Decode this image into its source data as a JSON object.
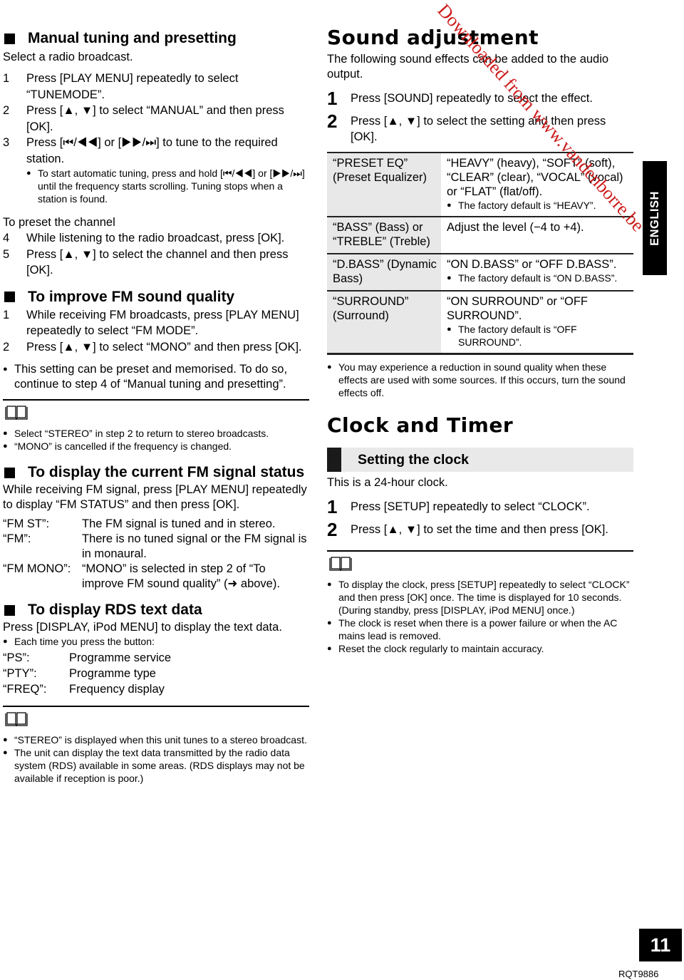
{
  "left": {
    "manual_tuning": {
      "title": "Manual tuning and presetting",
      "intro": "Select a radio broadcast.",
      "steps": [
        {
          "num": "1",
          "text": "Press [PLAY MENU] repeatedly to select “TUNEMODE”."
        },
        {
          "num": "2",
          "text": "Press [▲, ▼] to select “MANUAL” and then press [OK]."
        },
        {
          "num": "3",
          "text": "Press [⏮/◀◀] or [▶▶/⏭] to tune to the required station."
        }
      ],
      "step3_note": "To start automatic tuning, press and hold [⏮/◀◀] or [▶▶/⏭] until the frequency starts scrolling. Tuning stops when a station is found.",
      "preset_heading": "To preset the channel",
      "preset_steps": [
        {
          "num": "4",
          "text": "While listening to the radio broadcast, press [OK]."
        },
        {
          "num": "5",
          "text": "Press [▲, ▼] to select the channel and then press [OK]."
        }
      ]
    },
    "fm_quality": {
      "title": "To improve FM sound quality",
      "steps": [
        {
          "num": "1",
          "text": "While receiving FM broadcasts, press [PLAY MENU] repeatedly to select “FM MODE”."
        },
        {
          "num": "2",
          "text": "Press [▲, ▼] to select “MONO” and then press [OK]."
        }
      ],
      "note": "This setting can be preset and memorised. To do so, continue to step 4 of “Manual tuning and presetting”.",
      "tips_icon": "book-icon",
      "tips": [
        "Select “STEREO” in step 2 to return to stereo broadcasts.",
        "“MONO” is cancelled if the frequency is changed."
      ]
    },
    "fm_status": {
      "title": "To display the current FM signal status",
      "intro": "While receiving FM signal, press [PLAY MENU] repeatedly to display “FM STATUS” and then press [OK].",
      "items": [
        {
          "term": "“FM ST”:",
          "desc": "The FM signal is tuned and in stereo."
        },
        {
          "term": "“FM”:",
          "desc": "There is no tuned signal or the FM signal is in monaural."
        },
        {
          "term": "“FM MONO”:",
          "desc": "“MONO” is selected in step 2 of “To improve FM sound quality” (➜ above)."
        }
      ]
    },
    "rds": {
      "title": "To display RDS text data",
      "intro": "Press [DISPLAY, iPod MENU] to display the text data.",
      "bullet": "Each time you press the button:",
      "items": [
        {
          "term": "“PS”:",
          "desc": "Programme service"
        },
        {
          "term": "“PTY”:",
          "desc": "Programme type"
        },
        {
          "term": "“FREQ”:",
          "desc": "Frequency display"
        }
      ],
      "tips_icon": "book-icon",
      "tips": [
        "“STEREO” is displayed when this unit tunes to a stereo broadcast.",
        "The unit can display the text data transmitted by the radio data system (RDS) available in some areas. (RDS displays may not be available if reception is poor.)"
      ]
    }
  },
  "right": {
    "sound": {
      "title": "Sound adjustment",
      "intro": "The following sound effects can be added to the audio output.",
      "steps": [
        {
          "num": "1",
          "text": "Press [SOUND] repeatedly to select the effect."
        },
        {
          "num": "2",
          "text": "Press [▲, ▼] to select the setting and then press [OK]."
        }
      ],
      "table": [
        {
          "key": "“PRESET EQ” (Preset Equalizer)",
          "value": "“HEAVY” (heavy), “SOFT” (soft), “CLEAR” (clear), “VOCAL” (vocal) or “FLAT” (flat/off).",
          "note": "The factory default is “HEAVY”."
        },
        {
          "key": "“BASS” (Bass) or “TREBLE” (Treble)",
          "value": "Adjust the level (−4 to +4).",
          "note": ""
        },
        {
          "key": "“D.BASS” (Dynamic Bass)",
          "value": "“ON D.BASS” or “OFF D.BASS”.",
          "note": "The factory default is “ON D.BASS”."
        },
        {
          "key": "“SURROUND” (Surround)",
          "value": "“ON SURROUND” or “OFF SURROUND”.",
          "note": "The factory default is “OFF SURROUND”."
        }
      ],
      "note": "You may experience a reduction in sound quality when these effects are used with some sources. If this occurs, turn the sound effects off."
    },
    "clock": {
      "title": "Clock and Timer",
      "subtitle": "Setting the clock",
      "intro": "This is a 24-hour clock.",
      "steps": [
        {
          "num": "1",
          "text": "Press [SETUP] repeatedly to select “CLOCK”."
        },
        {
          "num": "2",
          "text": "Press [▲, ▼] to set the time and then press [OK]."
        }
      ],
      "tips_icon": "book-icon",
      "tips": [
        "To display the clock, press [SETUP] repeatedly to select “CLOCK” and then press [OK] once. The time is displayed for 10 seconds.\n(During standby, press [DISPLAY, iPod MENU] once.)",
        "The clock is reset when there is a power failure or when the AC mains lead is removed.",
        "Reset the clock regularly to maintain accuracy."
      ]
    }
  },
  "side_tab": "ENGLISH",
  "page_number": "11",
  "doc_code": "RQT9886",
  "watermark": "Downloaded from www.vandenborre.be",
  "colors": {
    "watermark": "#cc1b1b",
    "table_key_bg": "#e8e8e8",
    "banner_bg": "#e9e9e9"
  }
}
